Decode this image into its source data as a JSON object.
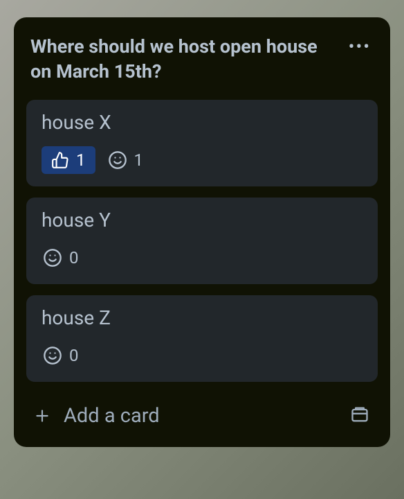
{
  "list": {
    "title": "Where should we host open house on March 15th?",
    "add_card_label": "Add a card",
    "cards": [
      {
        "title": "house X",
        "reactions": [
          {
            "type": "thumbs-up",
            "count": "1",
            "active": true
          },
          {
            "type": "smile",
            "count": "1",
            "active": false
          }
        ]
      },
      {
        "title": "house Y",
        "reactions": [
          {
            "type": "smile",
            "count": "0",
            "active": false
          }
        ]
      },
      {
        "title": "house Z",
        "reactions": [
          {
            "type": "smile",
            "count": "0",
            "active": false
          }
        ]
      }
    ]
  }
}
